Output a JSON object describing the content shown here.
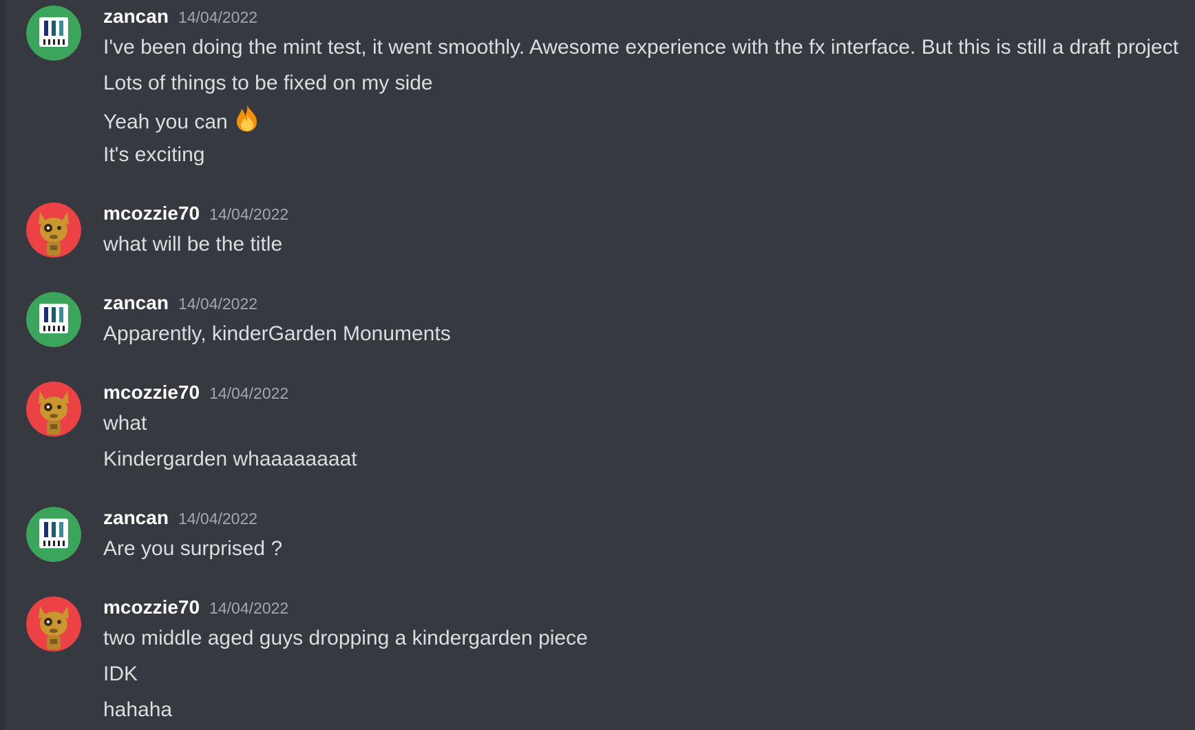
{
  "groups": [
    {
      "author": "zancan",
      "avatar": "zancan-piano-avatar",
      "timestamp": "14/04/2022",
      "messages": [
        "I've been doing the mint test, it went smoothly. Awesome experience with the fx interface. But this is still a draft project",
        "Lots of things to be fixed on my side",
        "Yeah you can",
        "It's exciting"
      ]
    },
    {
      "author": "mcozzie70",
      "avatar": "mcozzie70-cat-avatar",
      "timestamp": "14/04/2022",
      "messages": [
        "what will be the title"
      ]
    },
    {
      "author": "zancan",
      "avatar": "zancan-piano-avatar",
      "timestamp": "14/04/2022",
      "messages": [
        "Apparently, kinderGarden Monuments"
      ]
    },
    {
      "author": "mcozzie70",
      "avatar": "mcozzie70-cat-avatar",
      "timestamp": "14/04/2022",
      "messages": [
        "what",
        "Kindergarden whaaaaaaaat"
      ]
    },
    {
      "author": "zancan",
      "avatar": "zancan-piano-avatar",
      "timestamp": "14/04/2022",
      "messages": [
        "Are you surprised ?"
      ]
    },
    {
      "author": "mcozzie70",
      "avatar": "mcozzie70-cat-avatar",
      "timestamp": "14/04/2022",
      "messages": [
        "two middle aged guys dropping a kindergarden piece",
        "IDK",
        "hahaha"
      ]
    }
  ],
  "emoji": "fire-emoji",
  "colors": {
    "background": "#36393f",
    "username": "#ffffff",
    "timestamp": "#a3a6aa",
    "message": "#dcddde",
    "zancan_avatar_bg": "#3ba55c",
    "mcozzie_avatar_bg": "#ed4245"
  }
}
